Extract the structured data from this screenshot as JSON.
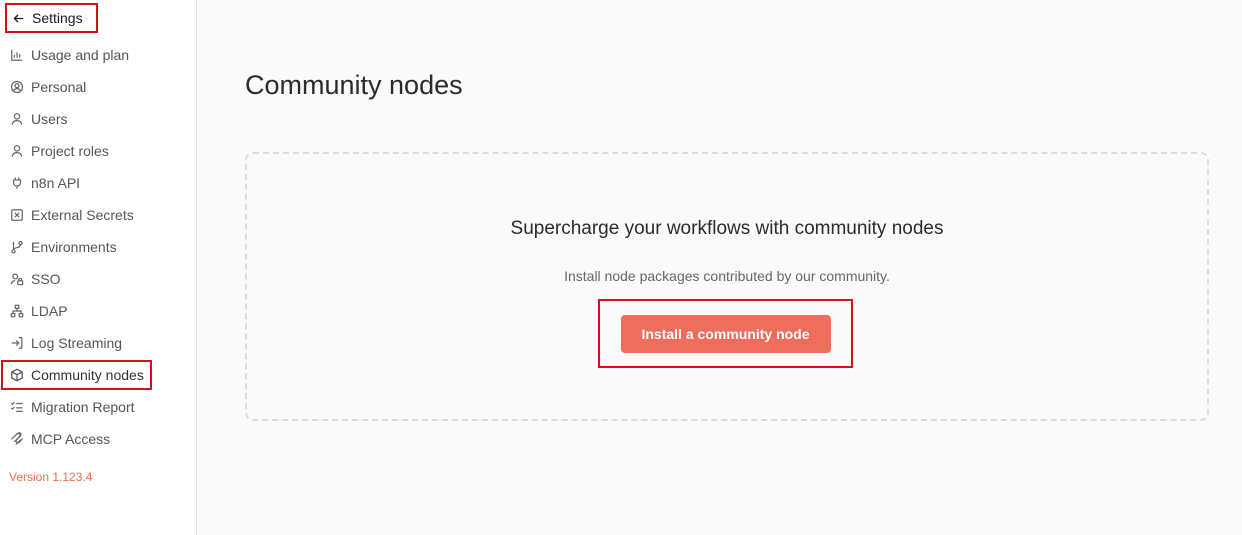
{
  "sidebar": {
    "back_label": "Settings",
    "items": [
      {
        "label": "Usage and plan",
        "icon": "chart-bar-icon"
      },
      {
        "label": "Personal",
        "icon": "user-circle-icon"
      },
      {
        "label": "Users",
        "icon": "user-icon"
      },
      {
        "label": "Project roles",
        "icon": "user-icon"
      },
      {
        "label": "n8n API",
        "icon": "plug-icon"
      },
      {
        "label": "External Secrets",
        "icon": "vault-icon"
      },
      {
        "label": "Environments",
        "icon": "git-branch-icon"
      },
      {
        "label": "SSO",
        "icon": "user-lock-icon"
      },
      {
        "label": "LDAP",
        "icon": "network-icon"
      },
      {
        "label": "Log Streaming",
        "icon": "sign-in-icon"
      },
      {
        "label": "Community nodes",
        "icon": "box-icon"
      },
      {
        "label": "Migration Report",
        "icon": "list-checks-icon"
      },
      {
        "label": "MCP Access",
        "icon": "mcp-icon"
      }
    ],
    "active_index": 10,
    "version": "Version 1.123.4"
  },
  "main": {
    "title": "Community nodes",
    "empty_state": {
      "heading": "Supercharge your workflows with community nodes",
      "description": "Install node packages contributed by our community.",
      "button_label": "Install a community node"
    }
  },
  "colors": {
    "accent": "#ef6d5c",
    "version": "#ea6d4e",
    "highlight": "#d0121b"
  }
}
